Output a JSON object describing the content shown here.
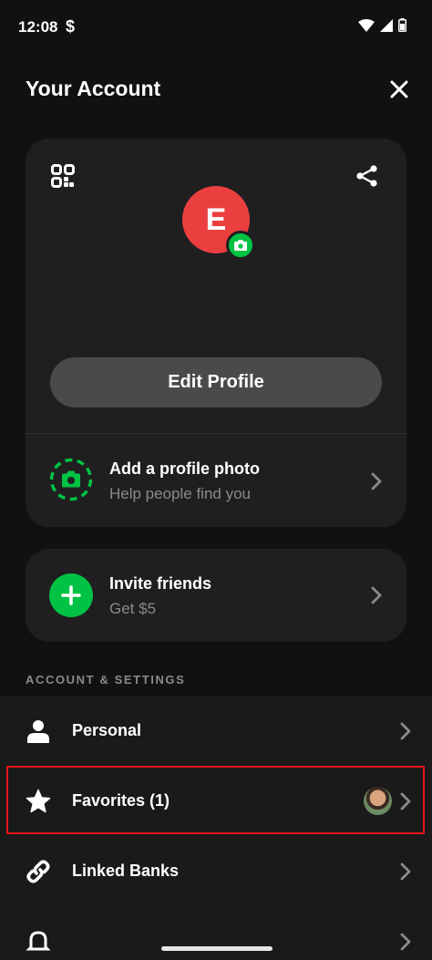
{
  "status_bar": {
    "time": "12:08",
    "dollar": "$"
  },
  "header": {
    "title": "Your Account"
  },
  "profile": {
    "avatar_initial": "E",
    "edit_button": "Edit Profile",
    "photo_row": {
      "title": "Add a profile photo",
      "subtitle": "Help people find you"
    }
  },
  "invite": {
    "title": "Invite friends",
    "subtitle": "Get $5"
  },
  "section": {
    "title": "ACCOUNT & SETTINGS"
  },
  "settings": {
    "items": [
      {
        "label": "Personal",
        "icon": "person-icon"
      },
      {
        "label": "Favorites (1)",
        "icon": "star-icon"
      },
      {
        "label": "Linked Banks",
        "icon": "link-icon"
      },
      {
        "label": "",
        "icon": "bell-icon"
      }
    ]
  },
  "colors": {
    "background": "#111111",
    "card": "#1f1f20",
    "accent_green": "#00c244",
    "avatar_red": "#eb3f3f",
    "highlight_red": "#e4141a"
  }
}
